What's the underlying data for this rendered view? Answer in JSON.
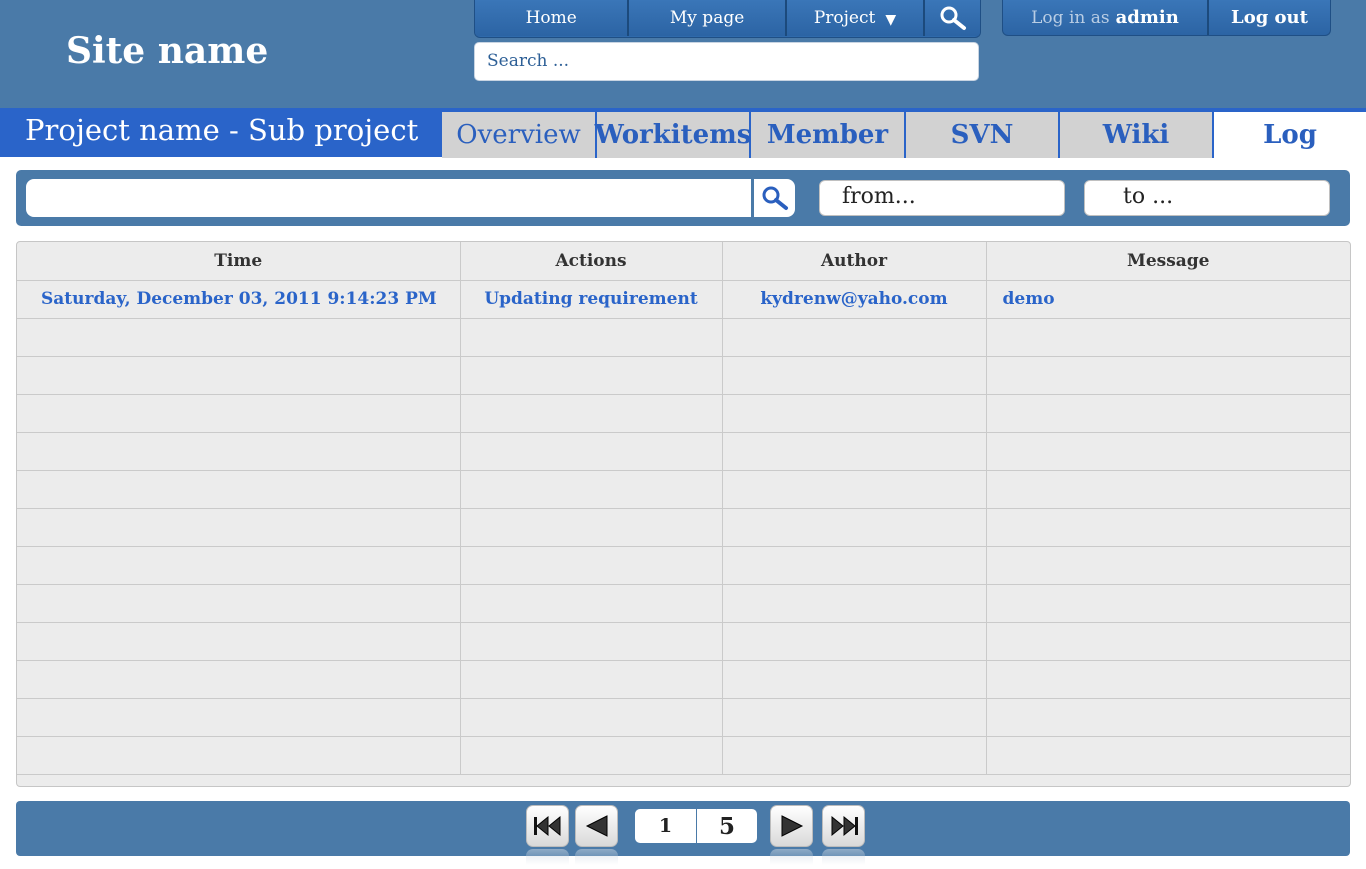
{
  "site": {
    "name": "Site name"
  },
  "top_nav": {
    "home": "Home",
    "my_page": "My page",
    "project": "Project",
    "search_placeholder": "Search ..."
  },
  "user": {
    "login_prefix": "Log in as",
    "username": "admin",
    "logout": "Log out"
  },
  "project": {
    "title": "Project name - Sub project"
  },
  "tabs": [
    {
      "label": "Overview",
      "active": false
    },
    {
      "label": "Workitems",
      "active": false
    },
    {
      "label": "Member",
      "active": false
    },
    {
      "label": "SVN",
      "active": false
    },
    {
      "label": "Wiki",
      "active": false
    },
    {
      "label": "Log",
      "active": true
    }
  ],
  "filter": {
    "search_value": "",
    "from_placeholder": "from...",
    "to_placeholder": "to ..."
  },
  "log_table": {
    "columns": [
      "Time",
      "Actions",
      "Author",
      "Message"
    ],
    "rows": [
      {
        "time": "Saturday, December 03, 2011 9:14:23 PM",
        "action": "Updating requirement",
        "author": "kydrenw@yaho.com",
        "message": "demo"
      }
    ]
  },
  "pagination": {
    "current_page": "1",
    "total_pages": "5"
  },
  "colors": {
    "header_bg": "#4a7aa8",
    "accent_blue": "#2a64c9",
    "nav_blue": "#2f6aab",
    "tab_inactive": "#d2d2d2",
    "table_bg": "#ececec"
  }
}
